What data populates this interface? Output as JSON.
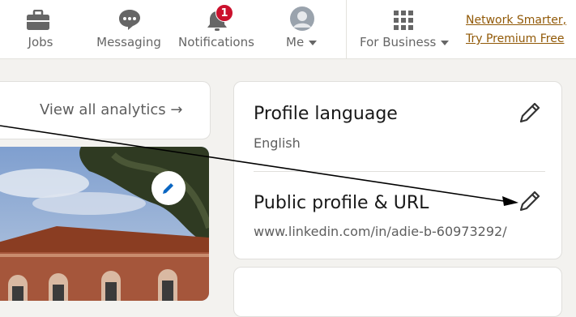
{
  "nav": {
    "jobs": "Jobs",
    "messaging": "Messaging",
    "notifications": "Notifications",
    "notifications_count": "1",
    "me": "Me",
    "for_business": "For Business",
    "premium_line1": "Network Smarter,",
    "premium_line2": "Try Premium Free"
  },
  "analytics": {
    "label": "View all analytics →"
  },
  "profile_language": {
    "title": "Profile language",
    "value": "English"
  },
  "public_profile": {
    "title": "Public profile & URL",
    "value": "www.linkedin.com/in/adie-b-60973292/"
  },
  "colors": {
    "premium": "#915907",
    "badge": "#cb112d",
    "text_secondary": "#5e5e5e",
    "link_blue": "#0a66c2"
  },
  "icons": [
    "briefcase-icon",
    "chat-icon",
    "bell-icon",
    "avatar",
    "grid-icon",
    "pencil-icon",
    "caret-down-icon"
  ]
}
